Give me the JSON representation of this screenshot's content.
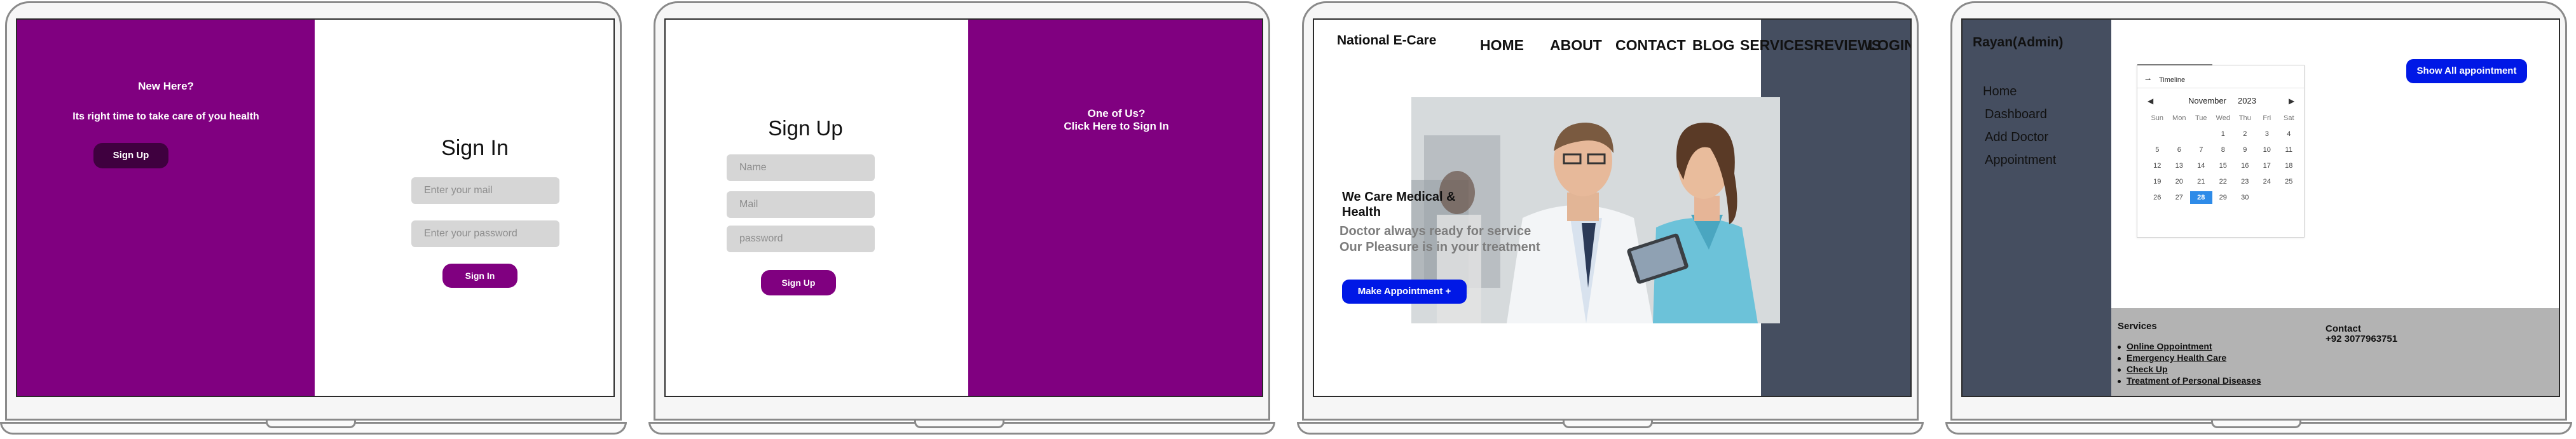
{
  "signin_screen": {
    "left_panel": {
      "heading": "New Here?",
      "tagline": "Its right  time to take care of you health",
      "signup_button": "Sign Up"
    },
    "form": {
      "title": "Sign In",
      "email_placeholder": "Enter your mail",
      "password_placeholder": "Enter your password",
      "signin_button": "Sign In"
    }
  },
  "signup_screen": {
    "form": {
      "title": "Sign Up",
      "name_placeholder": "Name",
      "mail_placeholder": "Mail",
      "password_placeholder": "password",
      "signup_button": "Sign Up"
    },
    "right_panel": {
      "line1": "One of Us?",
      "line2": "Click Here to Sign In"
    }
  },
  "home_screen": {
    "brand": "National E-Care",
    "nav": [
      "HOME",
      "ABOUT",
      "CONTACT",
      "BLOG",
      "SERVICES",
      "REVIEWS",
      "LOGIN"
    ],
    "hero": {
      "title_line1": "We Care Medical &",
      "title_line2": "Health",
      "subtitle_line1": "Doctor always ready for service",
      "subtitle_line2": "Our Pleasure is in your treatment",
      "cta": "Make Appointment +"
    }
  },
  "admin_screen": {
    "user": "Rayan(Admin)",
    "sidebar": [
      "Home",
      "Dashboard",
      "Add Doctor",
      "Appointment"
    ],
    "show_button": "Show All appointment",
    "timeline_label": "Timeline",
    "calendar": {
      "month": "November",
      "year": "2023",
      "weekdays": [
        "Sun",
        "Mon",
        "Tue",
        "Wed",
        "Thu",
        "Fri",
        "Sat"
      ],
      "weeks": [
        [
          "",
          "",
          "",
          "1",
          "2",
          "3",
          "4"
        ],
        [
          "5",
          "6",
          "7",
          "8",
          "9",
          "10",
          "11"
        ],
        [
          "12",
          "13",
          "14",
          "15",
          "16",
          "17",
          "18"
        ],
        [
          "19",
          "20",
          "21",
          "22",
          "23",
          "24",
          "25"
        ],
        [
          "26",
          "27",
          "28",
          "29",
          "30",
          "",
          ""
        ]
      ],
      "selected_day": "28"
    },
    "footer": {
      "services_heading": "Services",
      "services": [
        "Online Oppointment",
        "Emergency Health Care",
        "Check Up",
        "Treatment of Personal Diseases"
      ],
      "contact_heading": "Contact",
      "phone": "+92 3077963751"
    }
  },
  "colors": {
    "purple": "#800080",
    "slate": "#454e60",
    "blue_button": "#0018e6",
    "calendar_selected": "#2e8be8",
    "footer_gray": "#b3b3b3"
  }
}
